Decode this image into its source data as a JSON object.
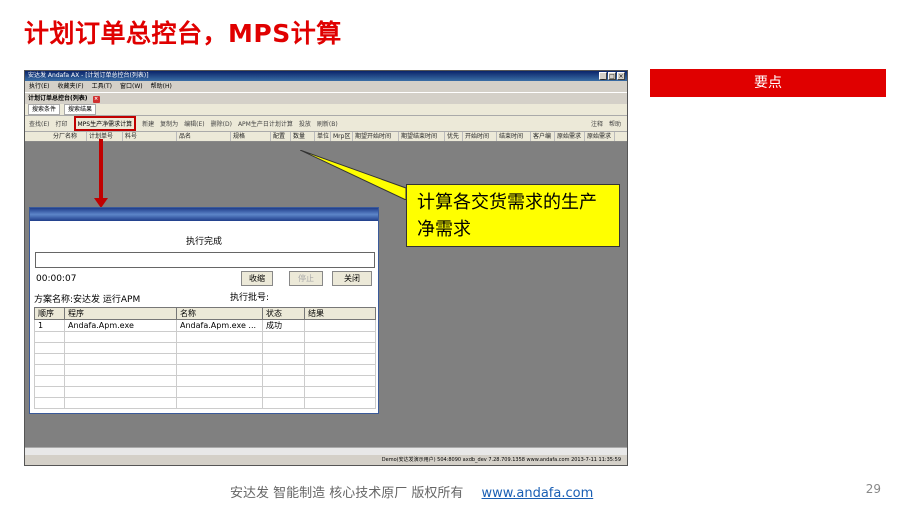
{
  "slide": {
    "title": "计划订单总控台，MPS计算",
    "keypoint": "要点",
    "callout": "计算各交货需求的生产净需求",
    "footer_text": "安达发  智能制造 核心技术原厂  版权所有",
    "footer_link": "www.andafa.com",
    "page_number": "29"
  },
  "window": {
    "title": "安达发 Andafa AX - [计划订单总控台(列表)]",
    "controls": [
      "_",
      "□",
      "×"
    ],
    "menu": [
      "执行(E)",
      "收藏夹(F)",
      "工具(T)",
      "窗口(W)",
      "帮助(H)"
    ],
    "doc_tab": "计划订单总控台(列表)",
    "sub_tabs": [
      "搜索条件",
      "搜索结果"
    ],
    "toolbar": {
      "left": [
        "查找(E)",
        "打印"
      ],
      "selected": "MPS生产净需求计算",
      "items": [
        "新建",
        "复制为",
        "编辑(E)",
        "删除(D)",
        "APM生产日计划计算",
        "投放",
        "刷新(B)"
      ],
      "right": [
        "注释",
        "帮助"
      ]
    },
    "columns": [
      "分厂名称",
      "计划单号",
      "料号",
      "品名",
      "规格",
      "配置",
      "数量",
      "单位",
      "Mrp区",
      "期望开始时间",
      "期望结束时间",
      "优先",
      "开始时间",
      "结束时间",
      "客户编",
      "原始需求",
      "原始需求"
    ],
    "status": "Demo(安达发演示用户)  504:8090  axdb_dev  7.28.709.1358  www.andafa.com  2013-7-11 11:35:59"
  },
  "dialog": {
    "status_text": "执行完成",
    "elapsed": "00:00:07",
    "buttons": {
      "collapse": "收缩",
      "stop": "停止",
      "close": "关闭"
    },
    "batch_label": "执行批号:",
    "plan_label": "方案名称:安达发 运行APM",
    "table_headers": [
      "顺序",
      "程序",
      "名称",
      "状态",
      "结果"
    ],
    "rows": [
      {
        "seq": "1",
        "program": "Andafa.Apm.exe",
        "name": "Andafa.Apm.exe ...",
        "state": "成功",
        "result": ""
      }
    ]
  }
}
